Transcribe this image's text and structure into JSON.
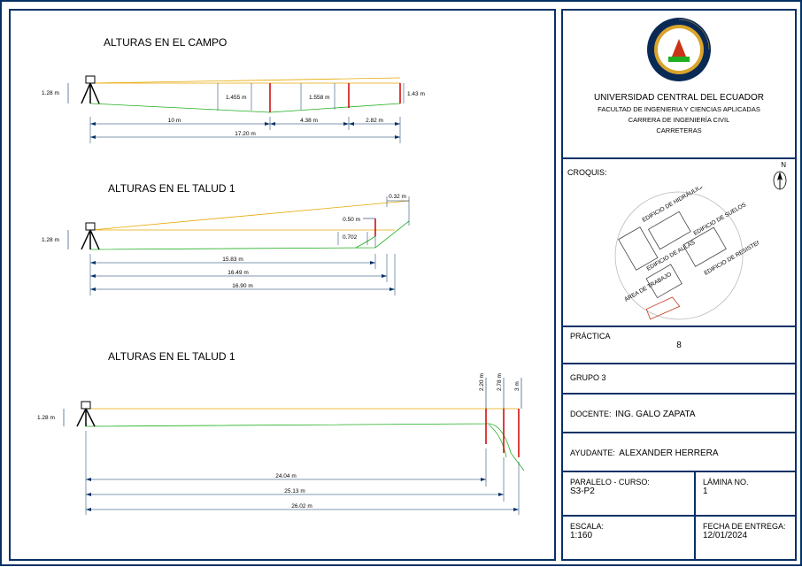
{
  "sections": {
    "campo": {
      "title": "ALTURAS EN EL CAMPO",
      "tripod_height": "1.28 m",
      "heights": [
        "1.455 m",
        "1.558 m",
        "1.43 m"
      ],
      "dims_below": [
        "10 m",
        "4.38 m",
        "2.82 m"
      ],
      "total": "17.20 m"
    },
    "talud1": {
      "title": "ALTURAS EN EL TALUD 1",
      "tripod_height": "1.28 m",
      "top_dim": "0.32 m",
      "extra_h": [
        "0.50 m",
        "0.702"
      ],
      "dims_below": [
        "15.83 m",
        "16.49 m",
        "16.90 m"
      ]
    },
    "talud2": {
      "title": "ALTURAS EN EL TALUD 1",
      "tripod_height": "1.28 m",
      "v_dims": [
        "2.20 m",
        "2.78 m",
        "3 m"
      ],
      "dims_below": [
        "24.04 m",
        "25.13 m",
        "26.02 m"
      ]
    }
  },
  "titleblock": {
    "university": "UNIVERSIDAD CENTRAL DEL ECUADOR",
    "faculty": "FACULTAD DE INGENIERIA Y CIENCIAS APLICADAS",
    "career": "CARRERA DE INGENIERÍA CIVIL",
    "subject": "CARRETERAS",
    "croquis_label": "CROQUIS:",
    "north": "N",
    "map_labels": [
      "EDIFICIO DE HIDRÁULICA",
      "EDIFICIO DE AULAS",
      "EDIFICIO DE SUELOS",
      "EDIFICIO DE RESISTENCIA",
      "ÁREA DE TRABAJO"
    ],
    "practica_key": "PRÁCTICA",
    "practica_val": "8",
    "grupo": "GRUPO 3",
    "docente_key": "DOCENTE:",
    "docente_val": "ING. GALO ZAPATA",
    "ayudante_key": "AYUDANTE:",
    "ayudante_val": "ALEXANDER HERRERA",
    "paralelo_key": "PARALELO - CURSO:",
    "paralelo_val": "S3-P2",
    "lamina_key": "LÁMINA No.",
    "lamina_val": "1",
    "escala_key": "ESCALA:",
    "escala_val": "1:160",
    "fecha_key": "FECHA DE ENTREGA:",
    "fecha_val": "12/01/2024"
  }
}
